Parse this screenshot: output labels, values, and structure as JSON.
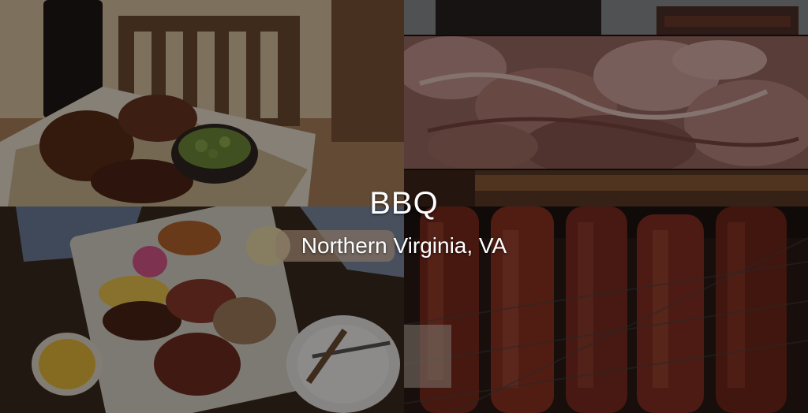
{
  "hero": {
    "title": "BBQ",
    "subtitle": "Northern Virginia, VA"
  },
  "collage": {
    "images": [
      {
        "name": "ribs-on-table-photo"
      },
      {
        "name": "top-strip-photo"
      },
      {
        "name": "pulled-pork-photo"
      },
      {
        "name": "cutting-board-photo"
      },
      {
        "name": "bbq-platter-photo"
      },
      {
        "name": "ribs-on-grill-photo"
      }
    ]
  },
  "colors": {
    "overlay": "#000000",
    "text": "#ffffff"
  }
}
